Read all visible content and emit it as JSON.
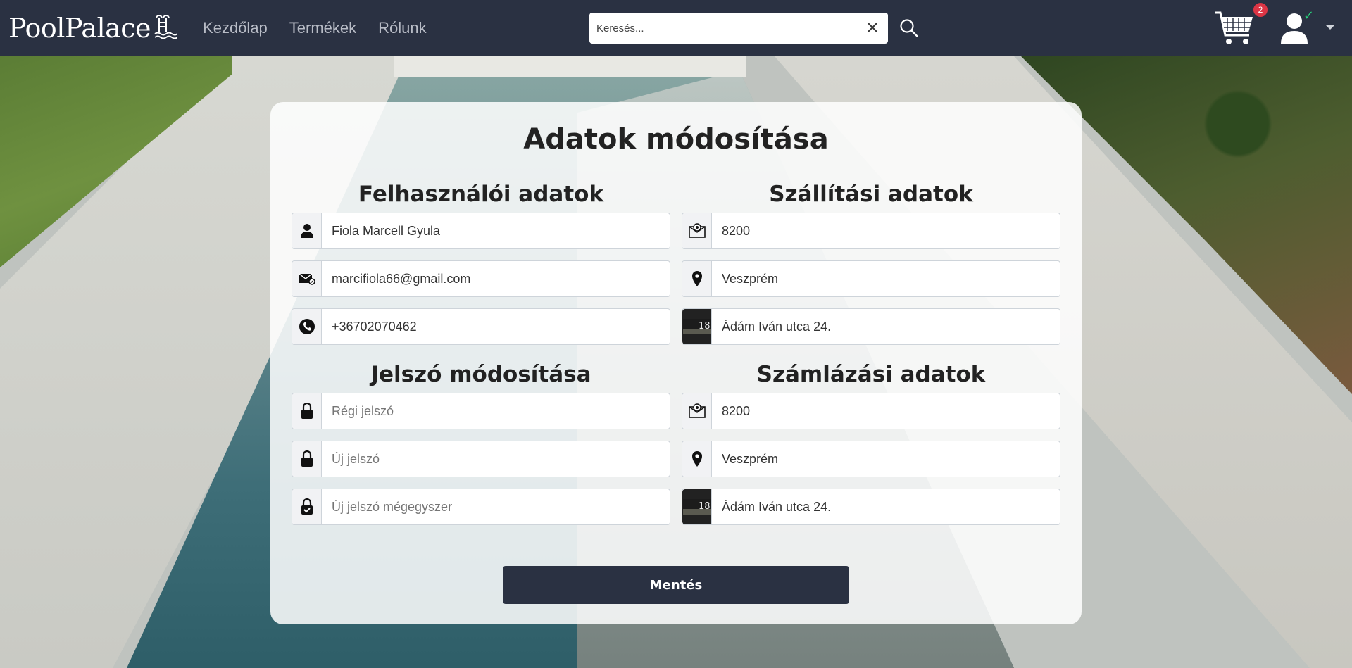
{
  "navbar": {
    "brand": "PoolPalace",
    "links": [
      "Kezdőlap",
      "Termékek",
      "Rólunk"
    ],
    "search_placeholder": "Keresés...",
    "cart_count": "2"
  },
  "page": {
    "title": "Adatok módosítása",
    "save_label": "Mentés"
  },
  "user_data": {
    "title": "Felhasználói adatok",
    "name": "Fiola Marcell Gyula",
    "email": "marcifiola66@gmail.com",
    "phone": "+36702070462"
  },
  "shipping": {
    "title": "Szállítási adatok",
    "zip": "8200",
    "city": "Veszprém",
    "address": "Ádám Iván utca 24."
  },
  "password": {
    "title": "Jelszó módosítása",
    "old_placeholder": "Régi jelszó",
    "new_placeholder": "Új jelszó",
    "confirm_placeholder": "Új jelszó mégegyszer"
  },
  "billing": {
    "title": "Számlázási adatok",
    "zip": "8200",
    "city": "Veszprém",
    "address": "Ádám Iván utca 24."
  },
  "icons": {
    "name": "person-icon",
    "email": "envelope-icon",
    "phone": "phone-icon",
    "zip": "mail-stamp-icon",
    "city": "map-pin-icon",
    "address": "house-number-icon",
    "lock": "lock-icon",
    "lock_check": "lock-check-icon",
    "cart": "cart-icon",
    "user": "user-icon",
    "search": "search-icon",
    "clear": "close-icon"
  },
  "colors": {
    "navbar": "#2a3142",
    "button": "#2a3142",
    "badge": "#dc3545",
    "status": "#28d17c"
  },
  "house_number_label": "18"
}
